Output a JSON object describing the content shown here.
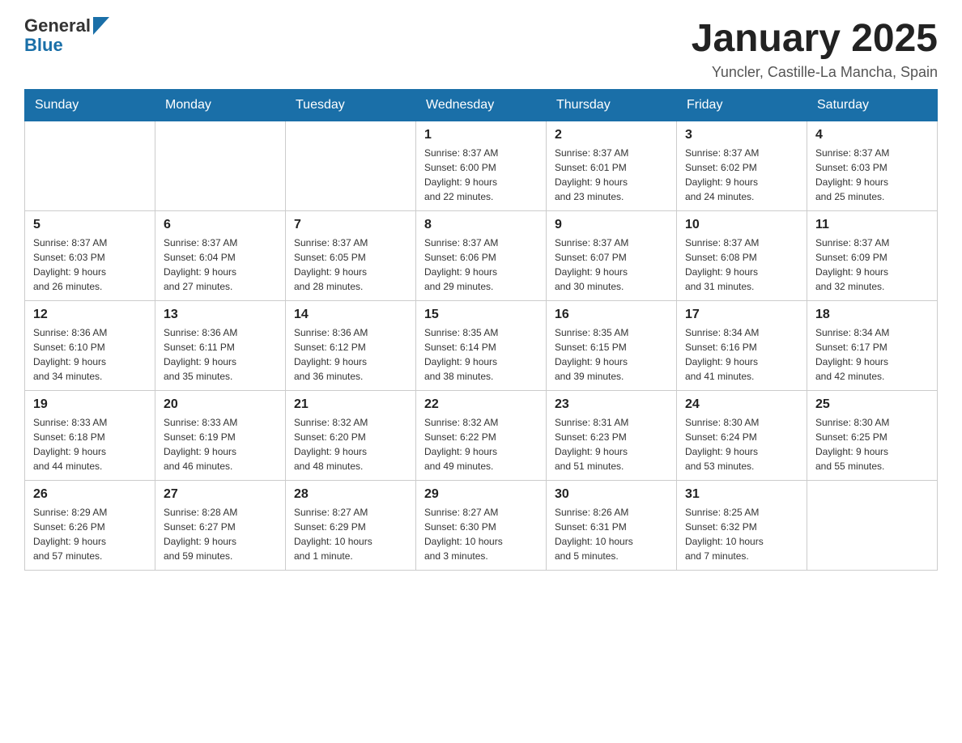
{
  "header": {
    "logo_general": "General",
    "logo_blue": "Blue",
    "title": "January 2025",
    "subtitle": "Yuncler, Castille-La Mancha, Spain"
  },
  "days_of_week": [
    "Sunday",
    "Monday",
    "Tuesday",
    "Wednesday",
    "Thursday",
    "Friday",
    "Saturday"
  ],
  "weeks": [
    {
      "days": [
        {
          "date": "",
          "info": ""
        },
        {
          "date": "",
          "info": ""
        },
        {
          "date": "",
          "info": ""
        },
        {
          "date": "1",
          "info": "Sunrise: 8:37 AM\nSunset: 6:00 PM\nDaylight: 9 hours\nand 22 minutes."
        },
        {
          "date": "2",
          "info": "Sunrise: 8:37 AM\nSunset: 6:01 PM\nDaylight: 9 hours\nand 23 minutes."
        },
        {
          "date": "3",
          "info": "Sunrise: 8:37 AM\nSunset: 6:02 PM\nDaylight: 9 hours\nand 24 minutes."
        },
        {
          "date": "4",
          "info": "Sunrise: 8:37 AM\nSunset: 6:03 PM\nDaylight: 9 hours\nand 25 minutes."
        }
      ]
    },
    {
      "days": [
        {
          "date": "5",
          "info": "Sunrise: 8:37 AM\nSunset: 6:03 PM\nDaylight: 9 hours\nand 26 minutes."
        },
        {
          "date": "6",
          "info": "Sunrise: 8:37 AM\nSunset: 6:04 PM\nDaylight: 9 hours\nand 27 minutes."
        },
        {
          "date": "7",
          "info": "Sunrise: 8:37 AM\nSunset: 6:05 PM\nDaylight: 9 hours\nand 28 minutes."
        },
        {
          "date": "8",
          "info": "Sunrise: 8:37 AM\nSunset: 6:06 PM\nDaylight: 9 hours\nand 29 minutes."
        },
        {
          "date": "9",
          "info": "Sunrise: 8:37 AM\nSunset: 6:07 PM\nDaylight: 9 hours\nand 30 minutes."
        },
        {
          "date": "10",
          "info": "Sunrise: 8:37 AM\nSunset: 6:08 PM\nDaylight: 9 hours\nand 31 minutes."
        },
        {
          "date": "11",
          "info": "Sunrise: 8:37 AM\nSunset: 6:09 PM\nDaylight: 9 hours\nand 32 minutes."
        }
      ]
    },
    {
      "days": [
        {
          "date": "12",
          "info": "Sunrise: 8:36 AM\nSunset: 6:10 PM\nDaylight: 9 hours\nand 34 minutes."
        },
        {
          "date": "13",
          "info": "Sunrise: 8:36 AM\nSunset: 6:11 PM\nDaylight: 9 hours\nand 35 minutes."
        },
        {
          "date": "14",
          "info": "Sunrise: 8:36 AM\nSunset: 6:12 PM\nDaylight: 9 hours\nand 36 minutes."
        },
        {
          "date": "15",
          "info": "Sunrise: 8:35 AM\nSunset: 6:14 PM\nDaylight: 9 hours\nand 38 minutes."
        },
        {
          "date": "16",
          "info": "Sunrise: 8:35 AM\nSunset: 6:15 PM\nDaylight: 9 hours\nand 39 minutes."
        },
        {
          "date": "17",
          "info": "Sunrise: 8:34 AM\nSunset: 6:16 PM\nDaylight: 9 hours\nand 41 minutes."
        },
        {
          "date": "18",
          "info": "Sunrise: 8:34 AM\nSunset: 6:17 PM\nDaylight: 9 hours\nand 42 minutes."
        }
      ]
    },
    {
      "days": [
        {
          "date": "19",
          "info": "Sunrise: 8:33 AM\nSunset: 6:18 PM\nDaylight: 9 hours\nand 44 minutes."
        },
        {
          "date": "20",
          "info": "Sunrise: 8:33 AM\nSunset: 6:19 PM\nDaylight: 9 hours\nand 46 minutes."
        },
        {
          "date": "21",
          "info": "Sunrise: 8:32 AM\nSunset: 6:20 PM\nDaylight: 9 hours\nand 48 minutes."
        },
        {
          "date": "22",
          "info": "Sunrise: 8:32 AM\nSunset: 6:22 PM\nDaylight: 9 hours\nand 49 minutes."
        },
        {
          "date": "23",
          "info": "Sunrise: 8:31 AM\nSunset: 6:23 PM\nDaylight: 9 hours\nand 51 minutes."
        },
        {
          "date": "24",
          "info": "Sunrise: 8:30 AM\nSunset: 6:24 PM\nDaylight: 9 hours\nand 53 minutes."
        },
        {
          "date": "25",
          "info": "Sunrise: 8:30 AM\nSunset: 6:25 PM\nDaylight: 9 hours\nand 55 minutes."
        }
      ]
    },
    {
      "days": [
        {
          "date": "26",
          "info": "Sunrise: 8:29 AM\nSunset: 6:26 PM\nDaylight: 9 hours\nand 57 minutes."
        },
        {
          "date": "27",
          "info": "Sunrise: 8:28 AM\nSunset: 6:27 PM\nDaylight: 9 hours\nand 59 minutes."
        },
        {
          "date": "28",
          "info": "Sunrise: 8:27 AM\nSunset: 6:29 PM\nDaylight: 10 hours\nand 1 minute."
        },
        {
          "date": "29",
          "info": "Sunrise: 8:27 AM\nSunset: 6:30 PM\nDaylight: 10 hours\nand 3 minutes."
        },
        {
          "date": "30",
          "info": "Sunrise: 8:26 AM\nSunset: 6:31 PM\nDaylight: 10 hours\nand 5 minutes."
        },
        {
          "date": "31",
          "info": "Sunrise: 8:25 AM\nSunset: 6:32 PM\nDaylight: 10 hours\nand 7 minutes."
        },
        {
          "date": "",
          "info": ""
        }
      ]
    }
  ]
}
